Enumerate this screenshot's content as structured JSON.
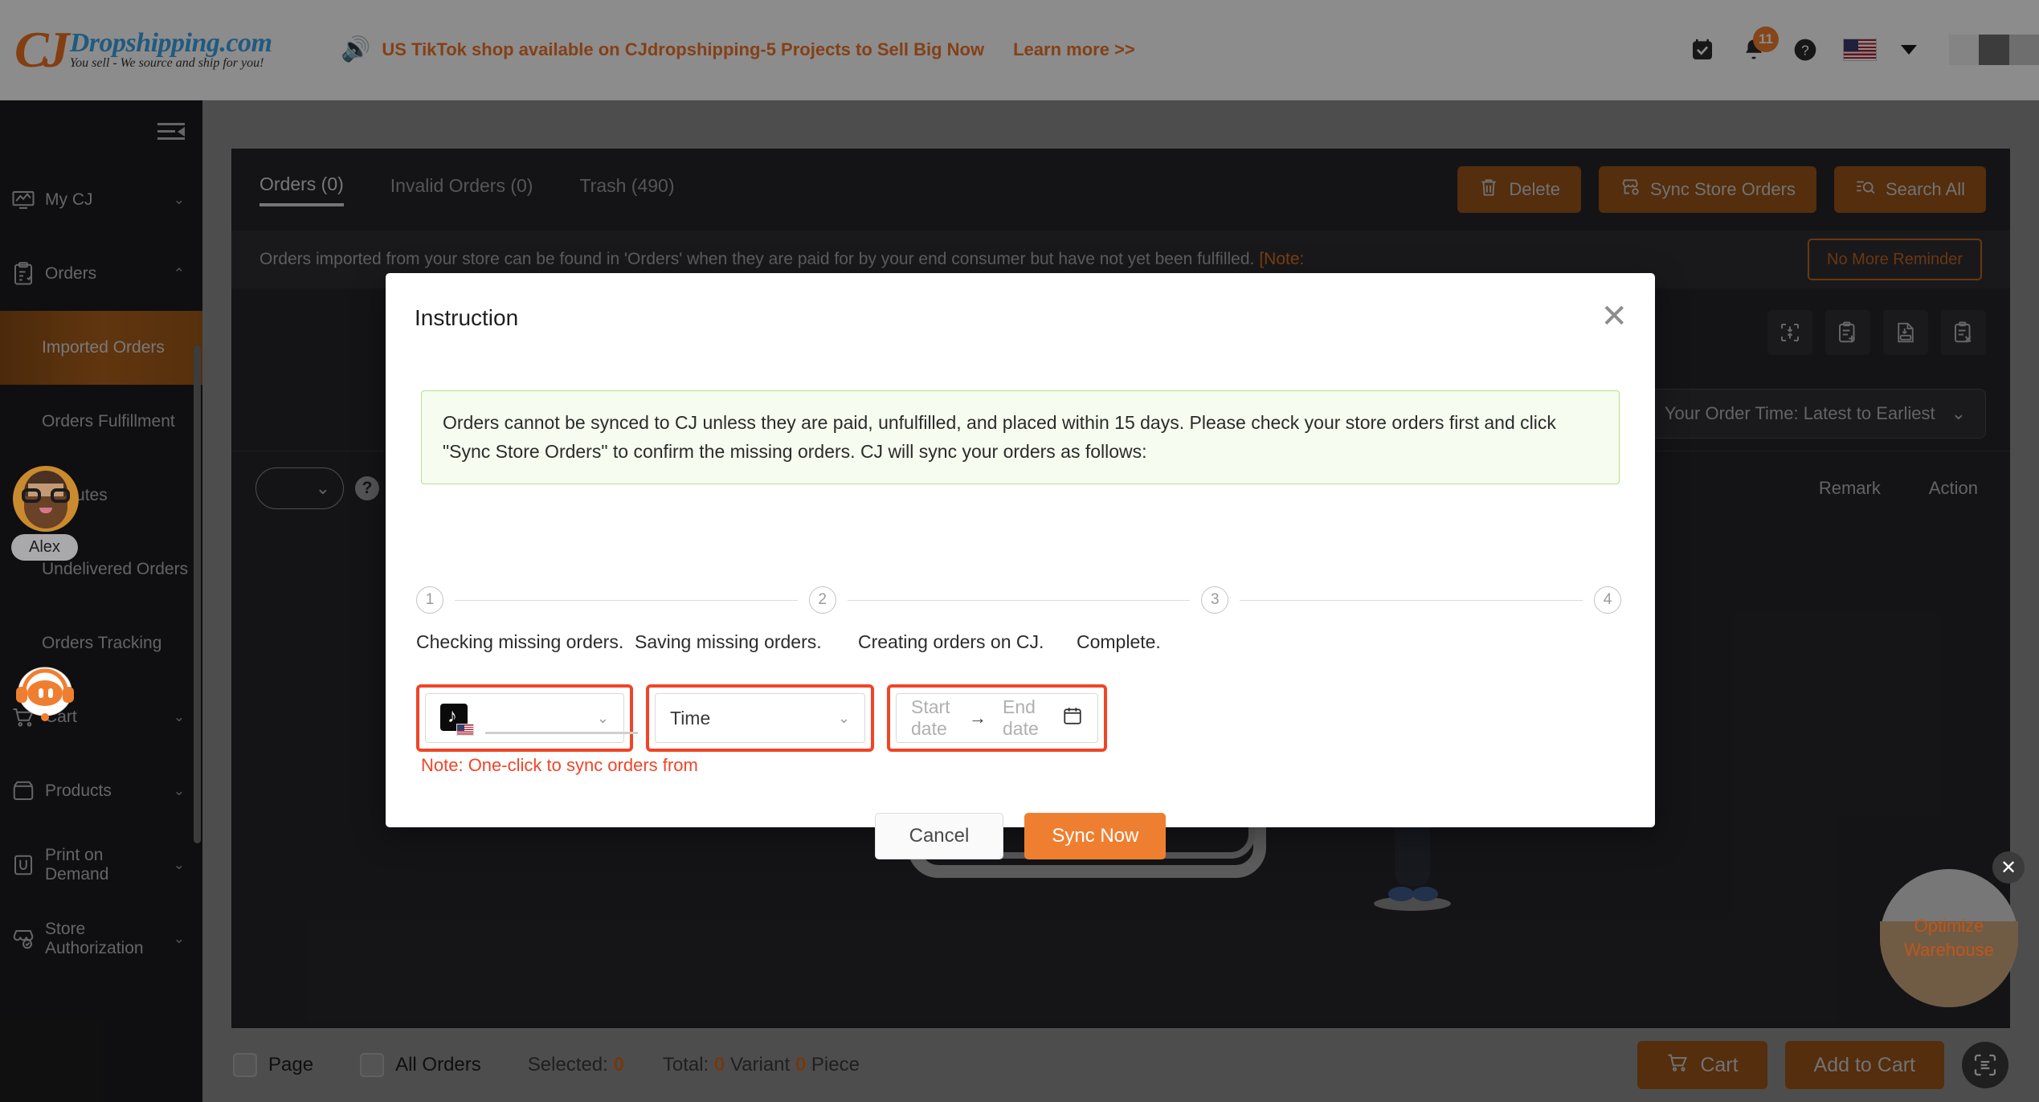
{
  "header": {
    "logo_mark": "CJ",
    "logo_title": "Dropshipping.com",
    "logo_subtitle": "You sell - We source and ship for you!",
    "promo_text": "US TikTok shop available on CJdropshipping-5 Projects to Sell Big Now",
    "promo_link": "Learn more >>",
    "speaker_icon": "speaker-icon",
    "tasks_icon": "tasks-check-icon",
    "bell_icon": "bell-icon",
    "notification_count": "11",
    "help_icon": "help-circle-icon",
    "flag_icon": "us-flag-icon",
    "language_caret": "chevron-down-icon",
    "accent_color": "#f0762b"
  },
  "sidebar": {
    "collapse_icon": "collapse-sidebar-icon",
    "items": [
      {
        "label": "My CJ",
        "icon": "dashboard-icon",
        "chevron": "chevron-down-icon"
      },
      {
        "label": "Orders",
        "icon": "orders-clipboard-icon",
        "chevron": "chevron-up-icon"
      }
    ],
    "sub_items": [
      {
        "label": "Imported Orders",
        "active": true
      },
      {
        "label": "Orders Fulfillment",
        "active": false
      },
      {
        "label": "Disputes",
        "active": false
      },
      {
        "label": "Undelivered Orders",
        "active": false
      },
      {
        "label": "Orders Tracking",
        "active": false
      }
    ],
    "lower_items": [
      {
        "label": "Cart",
        "icon": "cart-icon",
        "chevron": "chevron-down-icon"
      },
      {
        "label": "Products",
        "icon": "products-icon",
        "chevron": "chevron-down-icon"
      },
      {
        "label": "Print on Demand",
        "icon": "pod-icon",
        "chevron": "chevron-down-icon"
      },
      {
        "label": "Store Authorization",
        "icon": "store-auth-icon",
        "chevron": "chevron-down-icon"
      }
    ],
    "avatar_name": "Alex",
    "chatbot_icon": "chatbot-icon",
    "active_color": "#a05c19"
  },
  "content": {
    "tabs": [
      {
        "label": "Orders (0)",
        "active": true
      },
      {
        "label": "Invalid Orders (0)",
        "active": false
      },
      {
        "label": "Trash (490)",
        "active": false
      }
    ],
    "actions": [
      {
        "label": "Delete",
        "icon": "trash-icon"
      },
      {
        "label": "Sync Store Orders",
        "icon": "store-sync-icon"
      },
      {
        "label": "Search All",
        "icon": "search-filter-icon"
      }
    ],
    "notice_text": "Orders imported from your store can be found in 'Orders' when they are paid for by your end consumer but have not yet been fulfilled.",
    "notice_tail": "[Note:",
    "no_more_reminder": "No More Reminder",
    "toolbar_icons": [
      "import-export-icon",
      "add-order-icon",
      "download-excel-icon",
      "remove-order-icon"
    ],
    "sort_label": "Your Order Time: Latest to Earliest",
    "sort_caret": "chevron-down-icon",
    "table_headers": {
      "row_select_caret": "chevron-down-icon",
      "help_icon": "help-circle-icon",
      "remark": "Remark",
      "action": "Action"
    },
    "optimize_widget": {
      "line1": "Optimize",
      "line2": "Warehouse",
      "close_icon": "close-icon"
    }
  },
  "bottom_bar": {
    "page_checkbox_label": "Page",
    "all_orders_checkbox_label": "All Orders",
    "selected_label": "Selected:",
    "selected_count": "0",
    "total_label": "Total:",
    "total_variant": "0",
    "variant_word": "Variant",
    "total_piece": "0",
    "piece_word": "Piece",
    "cart_button": "Cart",
    "cart_icon": "cart-icon",
    "add_to_cart_button": "Add to Cart",
    "scan_icon": "scan-icon"
  },
  "modal": {
    "title": "Instruction",
    "close_icon": "close-icon",
    "notice": "Orders cannot be synced to CJ unless they are paid, unfulfilled, and placed within 15 days. Please check your store orders first and click \"Sync Store Orders\" to confirm the missing orders. CJ will sync your orders as follows:",
    "steps": [
      {
        "num": "1",
        "label": "Checking missing orders."
      },
      {
        "num": "2",
        "label": "Saving missing orders."
      },
      {
        "num": "3",
        "label": "Creating orders on CJ."
      },
      {
        "num": "4",
        "label": "Complete."
      }
    ],
    "store_select": {
      "value": "",
      "icon": "tiktok-store-icon",
      "caret": "chevron-down-icon"
    },
    "time_select": {
      "value": "Time",
      "caret": "chevron-down-icon"
    },
    "date_range": {
      "start_placeholder": "Start date",
      "separator": "→",
      "end_placeholder": "End date",
      "calendar_icon": "calendar-icon"
    },
    "hint": "Note: One-click to sync orders from",
    "cancel_button": "Cancel",
    "sync_button": "Sync Now",
    "highlight_color": "#f04527",
    "primary_color": "#ef7f30"
  }
}
